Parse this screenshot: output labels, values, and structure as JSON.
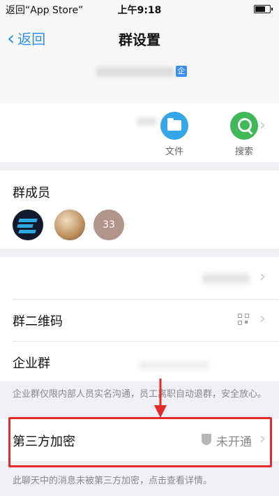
{
  "status_bar": {
    "back_label": "返回“App Store”",
    "time": "上午9:18"
  },
  "nav": {
    "back_label": "返回",
    "title": "群设置"
  },
  "group": {
    "corp_badge": "企"
  },
  "quick_actions": {
    "file_label": "文件",
    "search_label": "搜索"
  },
  "members": {
    "title": "群成员",
    "extra_count": "33"
  },
  "rows": {
    "qr_label": "群二维码",
    "corp_group_label": "企业群"
  },
  "corp_note": "企业群仅限内部人员实名沟通，员工离职自动退群，安全放心。",
  "encryption": {
    "label": "第三方加密",
    "status": "未开通",
    "note": "此聊天中的消息未被第三方加密，点击查看详情。"
  },
  "colors": {
    "accent": "#2f8ff0",
    "highlight": "#e32b2b",
    "file_icon": "#35a7e8",
    "search_icon": "#40b858"
  }
}
